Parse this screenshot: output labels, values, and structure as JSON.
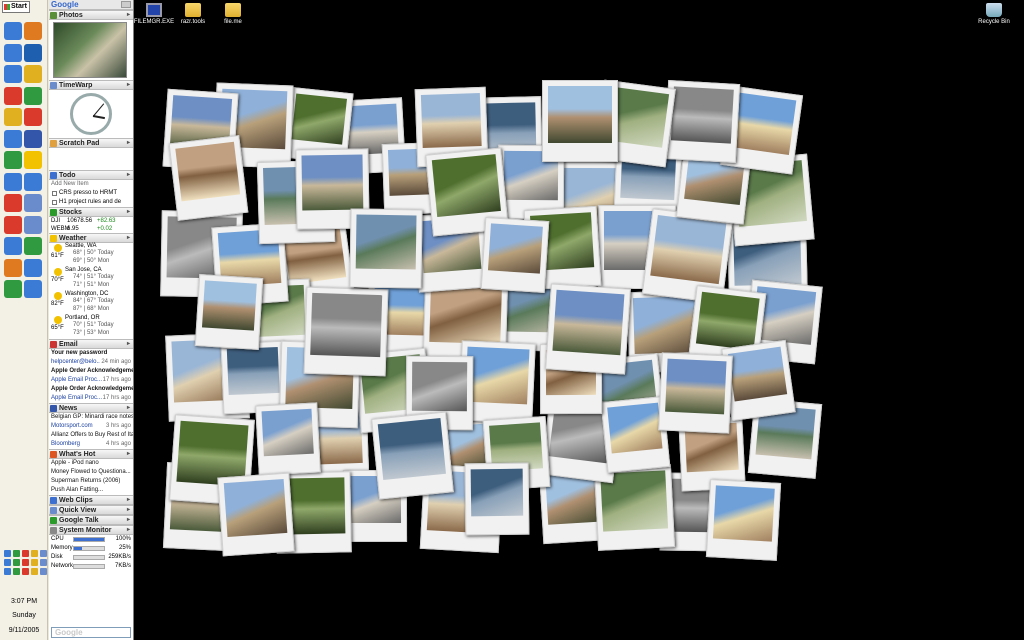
{
  "sidebar": {
    "start_label": "Start",
    "clock": {
      "time": "3:07 PM",
      "day": "Sunday",
      "date": "9/11/2005"
    },
    "photos_title": "Photos",
    "timewarp_title": "TimeWarp",
    "scratch_title": "Scratch Pad",
    "todo": {
      "title": "Todo",
      "add_placeholder": "Add New Item",
      "items": [
        "CRS presso to HRMT",
        "H1 project rules and de"
      ]
    },
    "stocks": {
      "title": "Stocks",
      "rows": [
        {
          "sym": "DJI",
          "val": "10678.56",
          "chg": "+82.63"
        },
        {
          "sym": "WEBM",
          "val": "6.95",
          "chg": "+0.02"
        }
      ]
    },
    "weather": {
      "title": "Weather",
      "cities": [
        {
          "city": "Seattle, WA",
          "now": "61°F",
          "d1": "68° | 50° Today",
          "d2": "69° | 50° Mon"
        },
        {
          "city": "San Jose, CA",
          "now": "70°F",
          "d1": "74° | 51° Today",
          "d2": "71° | 51° Mon"
        },
        {
          "city": "Washington, DC",
          "now": "82°F",
          "d1": "84° | 67° Today",
          "d2": "87° | 68° Mon"
        },
        {
          "city": "Portland, OR",
          "now": "65°F",
          "d1": "70° | 51° Today",
          "d2": "73° | 53° Mon"
        }
      ]
    },
    "email": {
      "title": "Email",
      "items": [
        {
          "subject": "Your new password",
          "from": "helpcenter@belo...",
          "time": "24 min ago"
        },
        {
          "subject": "Apple Order Acknowledgement-Orde...",
          "from": "Apple Email Proc...",
          "time": "17 hrs ago"
        },
        {
          "subject": "Apple Order Acknowledgement-Orde...",
          "from": "Apple Email Proc...",
          "time": "17 hrs ago"
        }
      ]
    },
    "news": {
      "title": "News",
      "items": [
        {
          "headline": "Belgian GP: Minardi race notes",
          "source": "Motorsport.com",
          "time": "3 hrs ago"
        },
        {
          "headline": "Allianz Offers to Buy Rest of Italy's RAS for $US 7 Billion",
          "source": "Bloomberg",
          "time": "4 hrs ago"
        }
      ]
    },
    "whatshot": {
      "title": "What's Hot",
      "items": [
        "Apple - iPod nano",
        "Money Flowed to Questiona...",
        "Superman Returns (2006)",
        "Push Alan Fatting..."
      ]
    },
    "webclips_title": "Web Clips",
    "quickview_title": "Quick View",
    "gtalk_title": "Google Talk",
    "sysmon": {
      "title": "System Monitor",
      "rows": [
        {
          "label": "CPU",
          "value": "100%",
          "fill": 1.0
        },
        {
          "label": "Memory",
          "value": "25%",
          "fill": 0.25
        },
        {
          "label": "Disk",
          "value": "259KB/s",
          "fill": 0.0
        },
        {
          "label": "Network",
          "value": "7KB/s",
          "fill": 0.0
        }
      ]
    },
    "search_logo": "Google"
  },
  "desktop": {
    "icons": [
      {
        "label": "FILEMGR.EXE",
        "icon": "floppy-icon"
      },
      {
        "label": "razr.tools",
        "icon": "folder-icon"
      },
      {
        "label": "file.me",
        "icon": "folder-icon"
      },
      {
        "label": "Recycle Bin",
        "icon": "recycle-bin-icon"
      }
    ]
  },
  "colors": {
    "desktop_bg": "#000000",
    "sidebar_bg": "#ece9d8",
    "accent_blue": "#3c6fd0",
    "polaroid_frame": "#f1f1f1"
  }
}
